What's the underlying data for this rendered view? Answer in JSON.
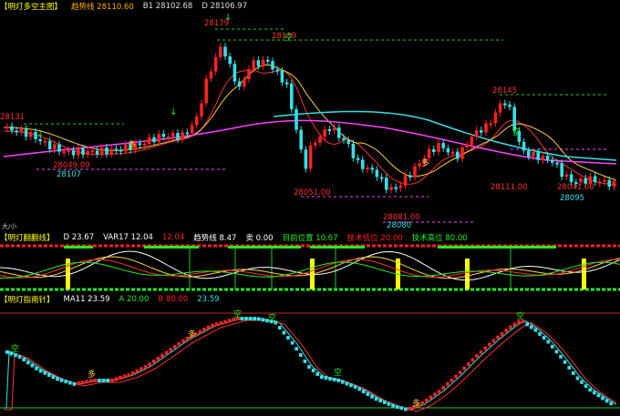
{
  "colors": {
    "up": "#ff2020",
    "down": "#33e0e8",
    "bg": "#000000",
    "yellow": "#ffff00",
    "green": "#22ee22",
    "magenta": "#ff40ff",
    "gold": "#ffb000"
  },
  "main": {
    "title": "【明灯多空主图】",
    "trend_label": "趋势线",
    "trend_value": "28110.60",
    "b1_label": "B1",
    "b1_value": "28102.68",
    "d_label": "D",
    "d_value": "28106.97",
    "price_labels": [
      "28179",
      "28139",
      "28131",
      "28107",
      "28095",
      "28080",
      "28051.00",
      "28049.00",
      "28081.00",
      "28145",
      "28041.00",
      "28111.00"
    ],
    "signal_buy": "多",
    "signal_empty": "空",
    "corner": "大/小"
  },
  "osc": {
    "title": "【明灯翻翻线】",
    "items": [
      {
        "label": "D",
        "value": "23.67",
        "color": "#ffffff"
      },
      {
        "label": "VAR17",
        "value": "12.04",
        "color": "#ffffff"
      },
      {
        "label": "",
        "value": "12.04",
        "color": "#ff2020"
      },
      {
        "label": "趋势线",
        "value": "8.47",
        "color": "#ffffff"
      },
      {
        "label": "卖",
        "value": "0.00",
        "color": "#ffffff"
      },
      {
        "label": "目前位置",
        "value": "10.67",
        "color": "#22ee22"
      },
      {
        "label": "技术低位",
        "value": "20.00",
        "color": "#ff2020"
      },
      {
        "label": "技术高位",
        "value": "80.00",
        "color": "#22ee22"
      }
    ]
  },
  "guide": {
    "title": "【明灯指南针】",
    "items": [
      {
        "label": "MA11",
        "value": "23.59",
        "color": "#ffffff"
      },
      {
        "label": "A",
        "value": "20.00",
        "color": "#22ee22"
      },
      {
        "label": "B",
        "value": "80.00",
        "color": "#ff2020"
      },
      {
        "label": "",
        "value": "23.59",
        "color": "#33e0e8"
      }
    ],
    "signal_buy": "多",
    "signal_empty": "空"
  }
}
